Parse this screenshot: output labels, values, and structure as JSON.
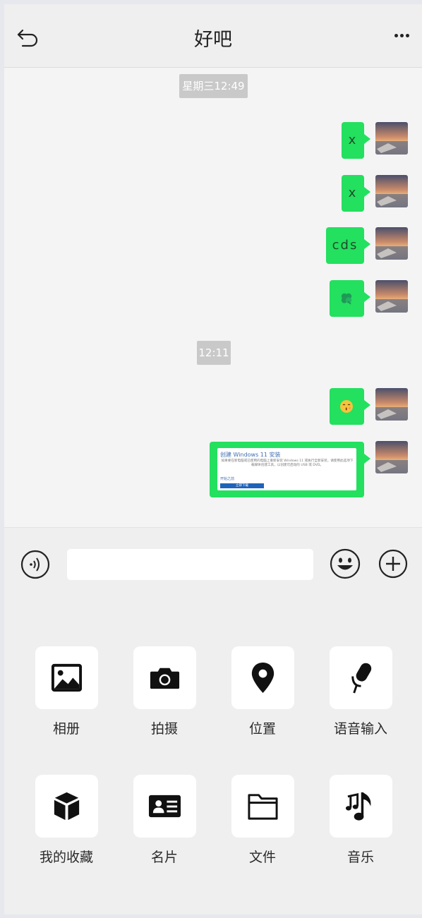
{
  "header": {
    "title": "好吧",
    "back_icon": "back-arrow-icon",
    "more_icon": "more-dots-icon"
  },
  "chat": {
    "timestamps": [
      "星期三12:49",
      "12:11"
    ],
    "messages": [
      {
        "type": "text",
        "text": "x"
      },
      {
        "type": "text",
        "text": "x"
      },
      {
        "type": "text",
        "text": "cds"
      },
      {
        "type": "emoji",
        "emoji": "💚",
        "icon": "clover-emoji-icon"
      },
      {
        "type": "emoji",
        "emoji": "😚",
        "icon": "kissing-face-emoji-icon"
      },
      {
        "type": "document",
        "doc_title": "创建 Windows 11 安装",
        "doc_body": "如果要在新电脑或已使用的电脑上重新安装 Windows 11 或执行全新安装，请使用此选项下载媒体创建工具，以创建可启动的 USB 或 DVD。",
        "doc_link": "开始之前",
        "doc_button": "立即下载"
      }
    ]
  },
  "input_bar": {
    "voice_icon": "voice-icon",
    "input_value": "",
    "input_placeholder": "",
    "emoji_icon": "emoji-icon",
    "plus_icon": "plus-icon"
  },
  "tools": [
    {
      "label": "相册",
      "icon": "album-icon"
    },
    {
      "label": "拍摄",
      "icon": "camera-icon"
    },
    {
      "label": "位置",
      "icon": "location-icon"
    },
    {
      "label": "语音输入",
      "icon": "microphone-icon"
    },
    {
      "label": "我的收藏",
      "icon": "favorites-cube-icon"
    },
    {
      "label": "名片",
      "icon": "contact-card-icon"
    },
    {
      "label": "文件",
      "icon": "folder-icon"
    },
    {
      "label": "音乐",
      "icon": "music-icon"
    }
  ],
  "colors": {
    "bubble": "#23e05f",
    "chat_bg": "#f4f4f4",
    "panel_bg": "#efefef",
    "timestamp_bg": "#c9c9c9"
  }
}
